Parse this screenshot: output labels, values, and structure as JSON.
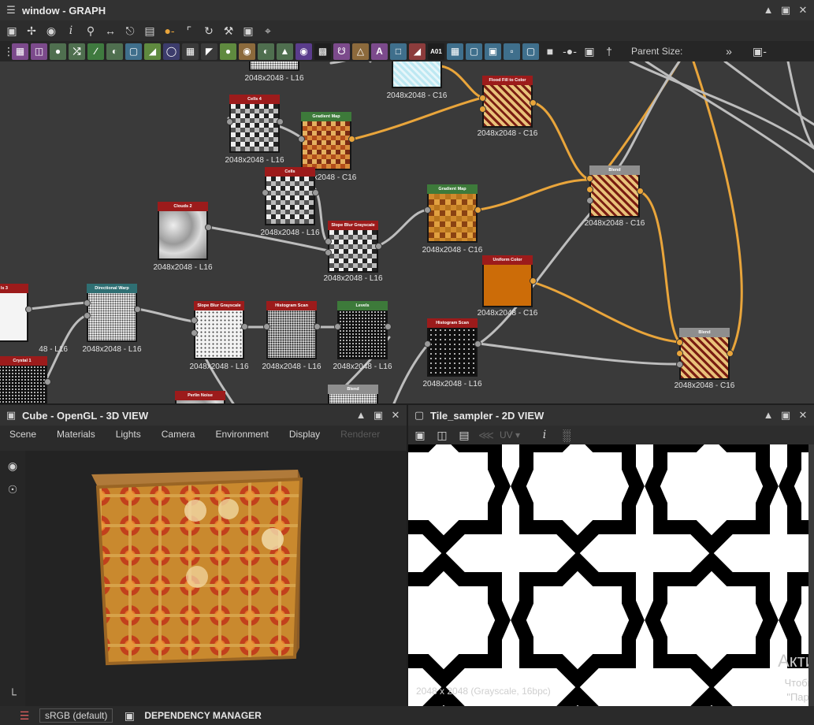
{
  "graph_window": {
    "title": "window - GRAPH",
    "parent_size_label": "Parent Size:",
    "nodes": [
      {
        "name": "",
        "caption": "2048x2048 - L16"
      },
      {
        "name": "",
        "caption": "2048x2048 - C16"
      },
      {
        "name": "Flood Fill to Color",
        "caption": "2048x2048 - C16"
      },
      {
        "name": "Cells 4",
        "caption": "2048x2048 - L16"
      },
      {
        "name": "Gradient Map",
        "caption": "2048x2048 - C16"
      },
      {
        "name": "Cells",
        "caption": "2048x2048 - L16"
      },
      {
        "name": "Clouds 2",
        "caption": "2048x2048 - L16"
      },
      {
        "name": "Slope Blur Grayscale",
        "caption": "2048x2048 - L16"
      },
      {
        "name": "Gradient Map",
        "caption": "2048x2048 - C16"
      },
      {
        "name": "Blend",
        "caption": "2048x2048 - C16"
      },
      {
        "name": "Uniform Color",
        "caption": "2048x2048 - C16"
      },
      {
        "name": "ls 3",
        "caption": "48 - L16"
      },
      {
        "name": "Directional Warp",
        "caption": "2048x2048 - L16"
      },
      {
        "name": "Slope Blur Grayscale",
        "caption": "2048x2048 - L16"
      },
      {
        "name": "Histogram Scan",
        "caption": "2048x2048 - L16"
      },
      {
        "name": "Levels",
        "caption": "2048x2048 - L16"
      },
      {
        "name": "Histogram Scan",
        "caption": "2048x2048 - L16"
      },
      {
        "name": "Blend",
        "caption": "2048x2048 - C16"
      },
      {
        "name": "Crystal 1",
        "caption": ""
      },
      {
        "name": "Perlin Noise",
        "caption": ""
      },
      {
        "name": "Blend",
        "caption": ""
      }
    ]
  },
  "view3d": {
    "title": "Cube - OpenGL - 3D VIEW",
    "menu": [
      "Scene",
      "Materials",
      "Lights",
      "Camera",
      "Environment",
      "Display",
      "Renderer"
    ]
  },
  "view2d": {
    "title": "Tile_sampler - 2D VIEW",
    "uv_label": "UV",
    "info": "2048 x 2048 (Grayscale, 16bpc)",
    "watermark_1": "Акти",
    "watermark_2": "Чтобы",
    "watermark_3": "\"Пара"
  },
  "statusbar": {
    "colorspace": "sRGB (default)",
    "dependency_manager": "DEPENDENCY MANAGER"
  },
  "colors": {
    "accent_wire": "#e9a53b",
    "node_header_red": "#9c1b1b",
    "node_header_green": "#3d7a3a",
    "node_header_gray": "#8e8e8e",
    "uniform_orange": "#cc6c08"
  }
}
